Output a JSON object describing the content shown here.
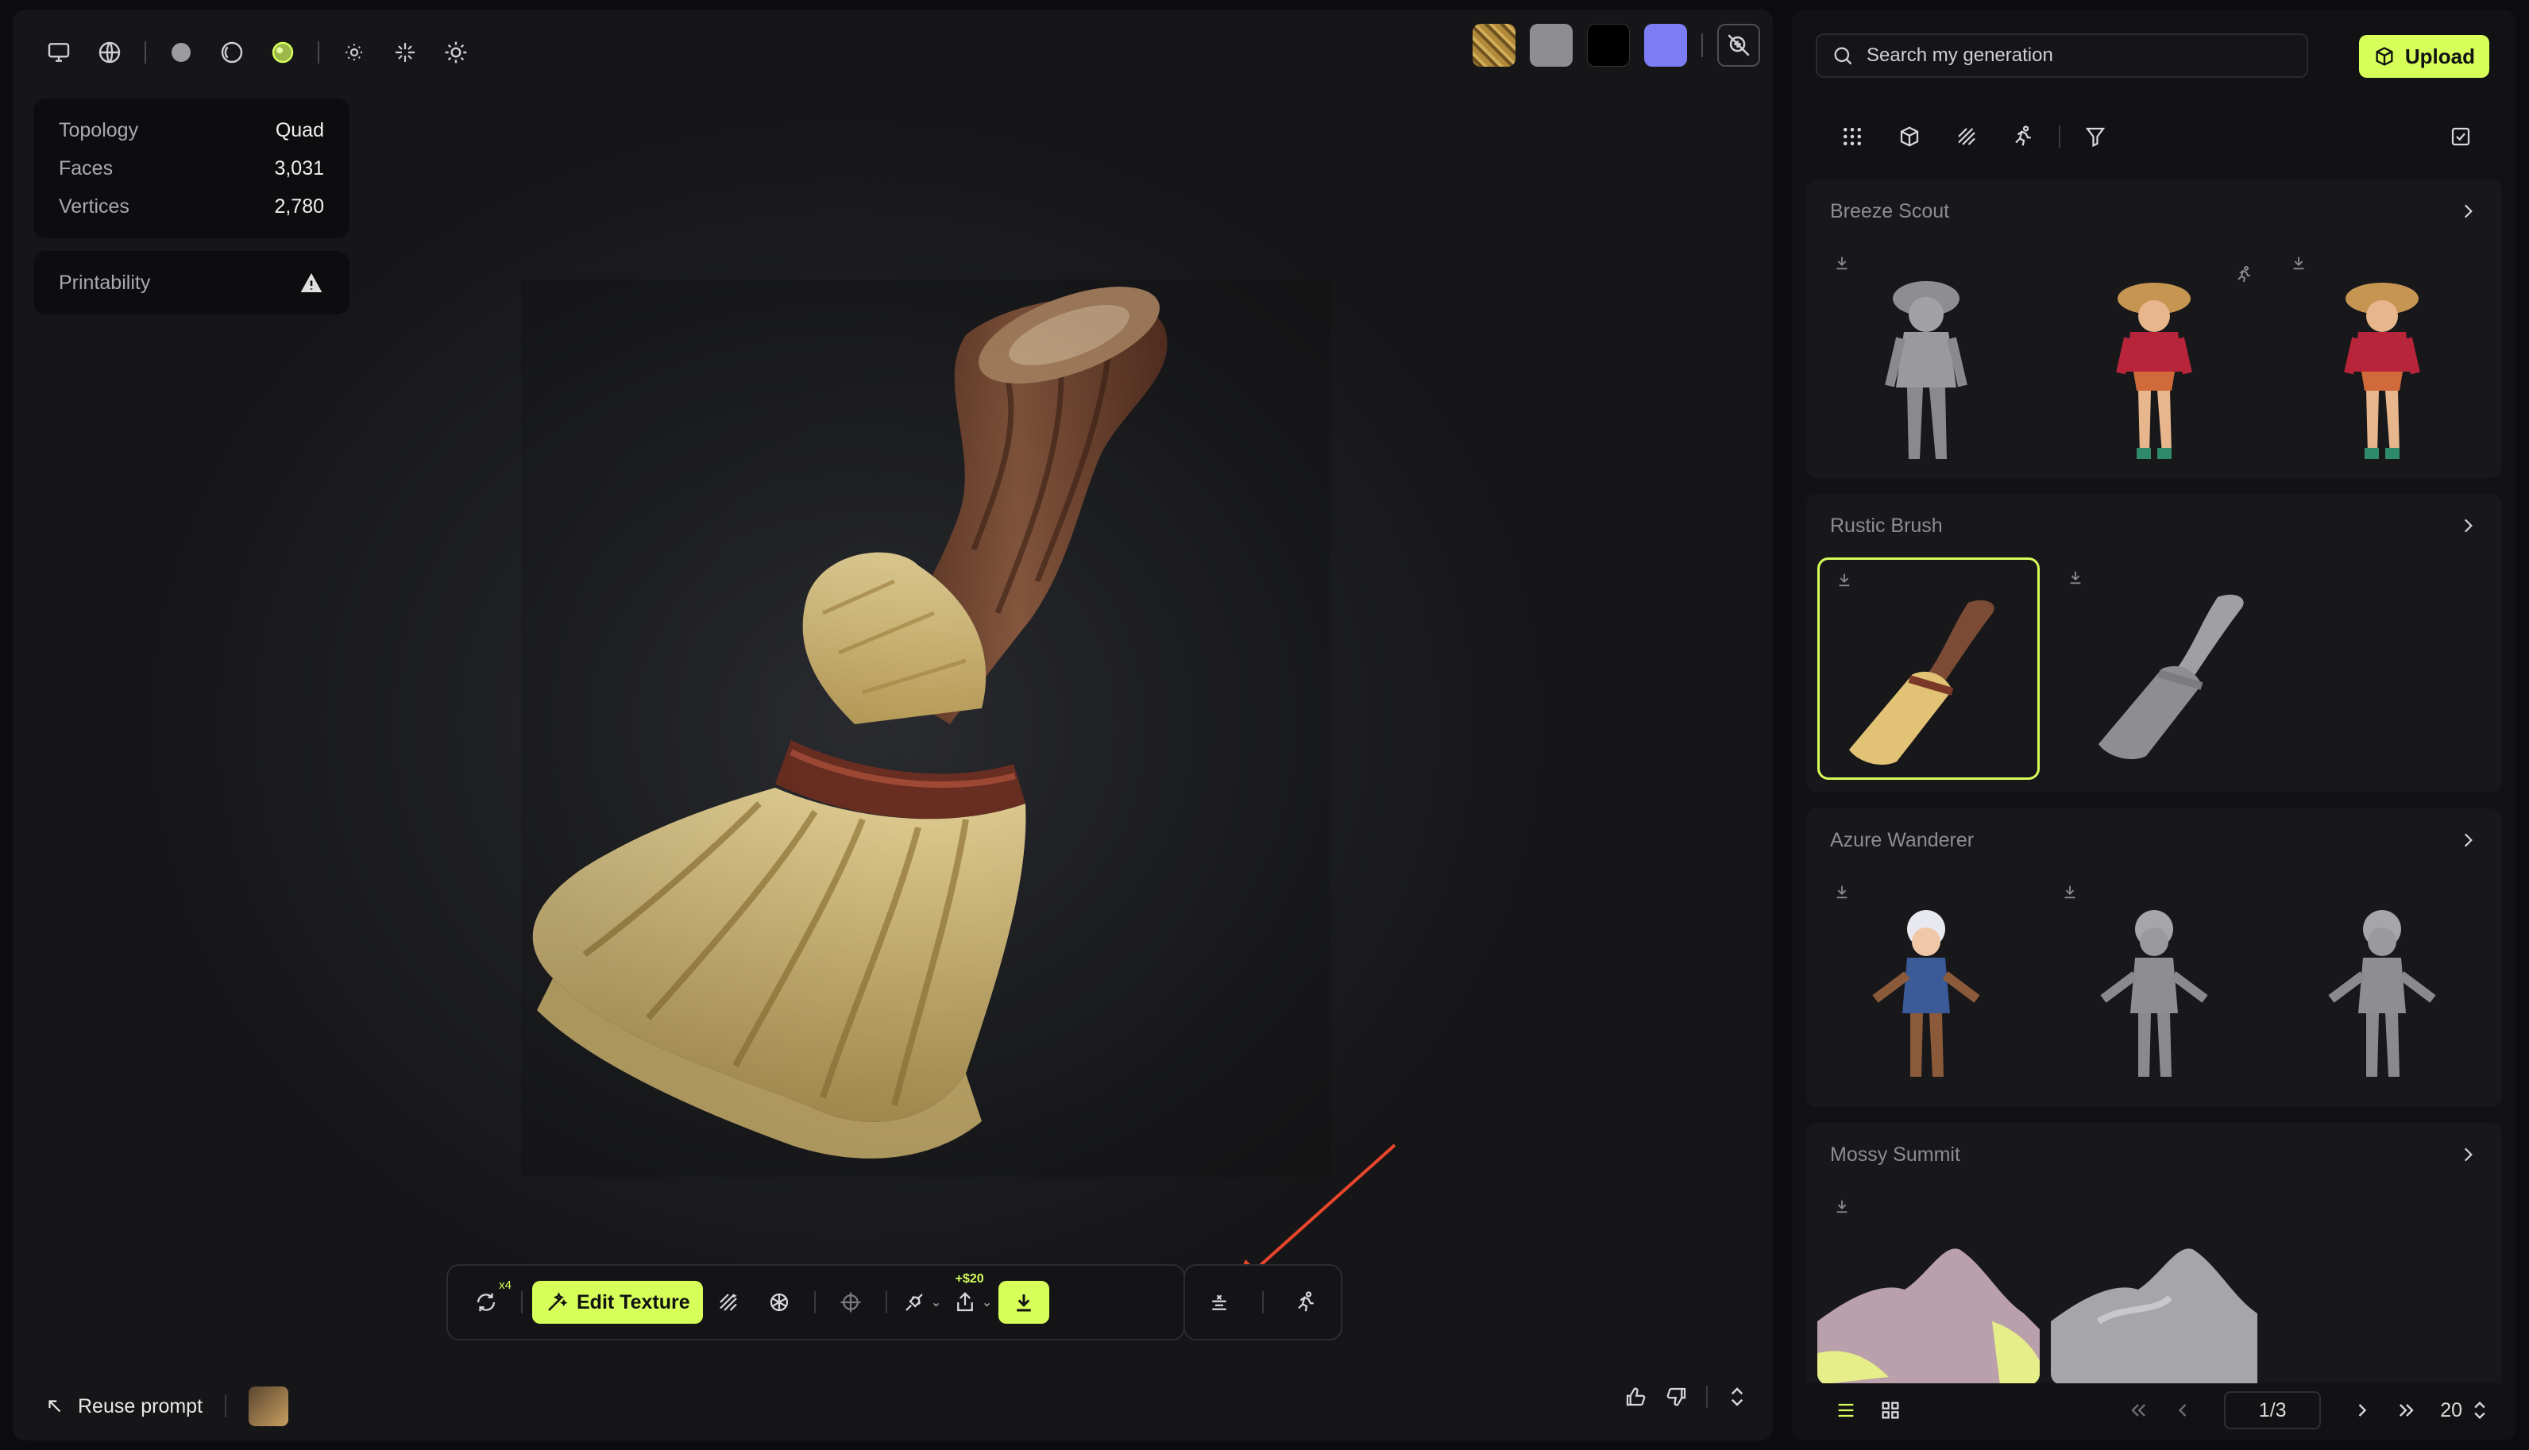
{
  "viewer": {
    "stats": [
      {
        "label": "Topology",
        "value": "Quad"
      },
      {
        "label": "Faces",
        "value": "3,031"
      },
      {
        "label": "Vertices",
        "value": "2,780"
      }
    ],
    "printability_label": "Printability",
    "toolbar": {
      "regen_badge": "x4",
      "edit_texture_label": "Edit Texture",
      "export_price": "+$20"
    },
    "reuse_prompt_label": "Reuse prompt",
    "accent_color": "#d6ff5a"
  },
  "panel": {
    "search_placeholder": "Search my generation",
    "upload_label": "Upload",
    "groups": [
      {
        "title": "Breeze Scout"
      },
      {
        "title": "Rustic Brush"
      },
      {
        "title": "Azure Wanderer"
      },
      {
        "title": "Mossy Summit"
      }
    ],
    "pagination": {
      "page": "1/3",
      "per_page": "20"
    }
  }
}
